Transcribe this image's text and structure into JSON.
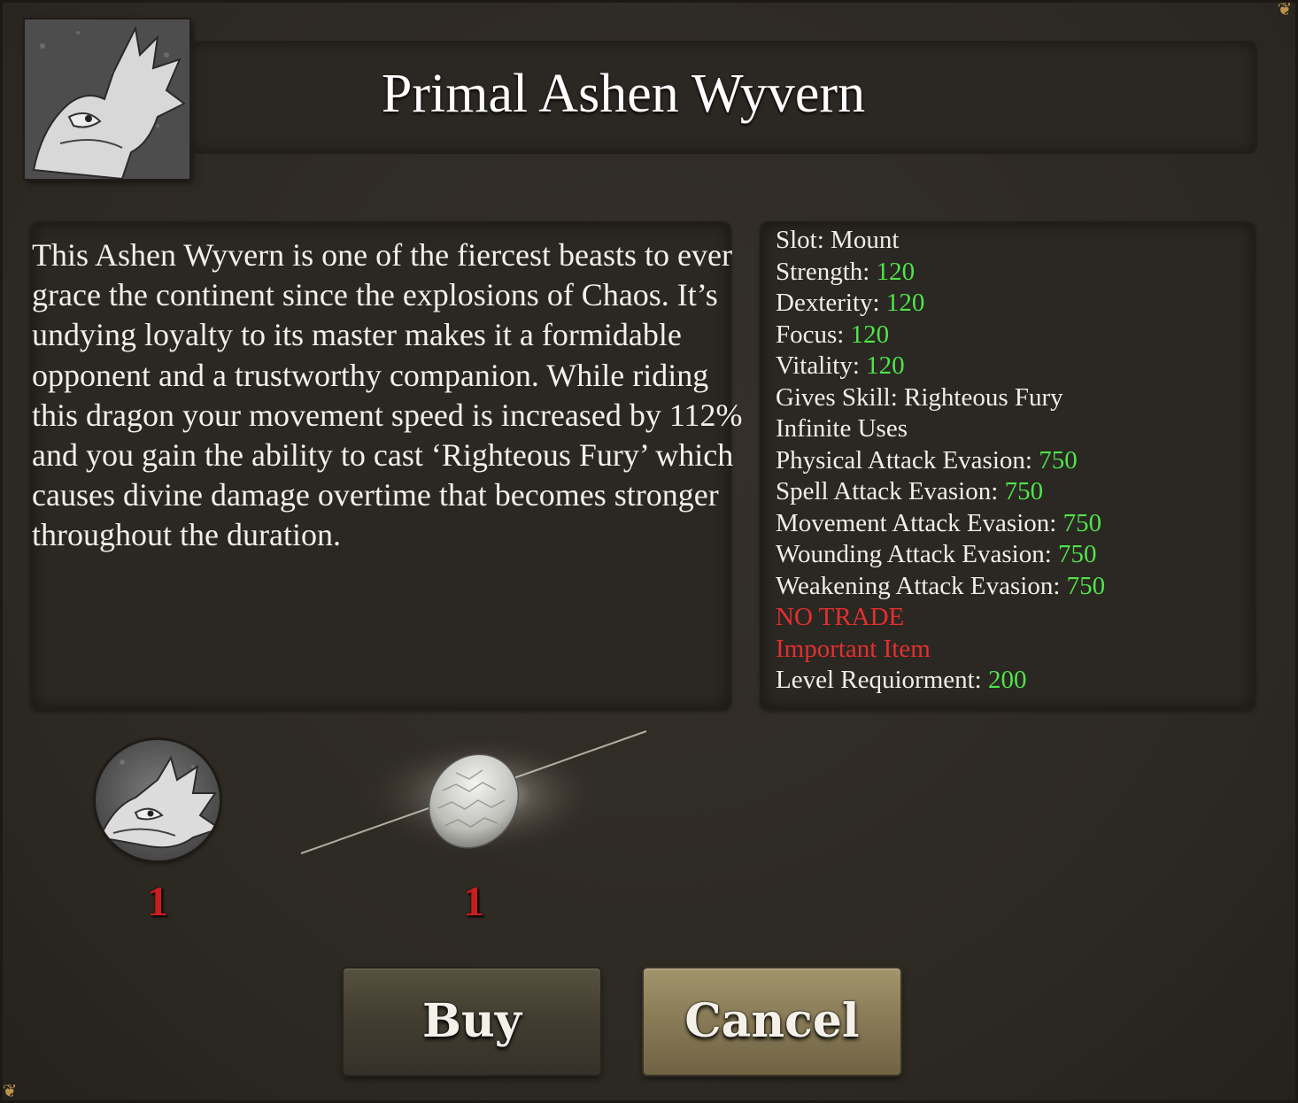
{
  "item": {
    "name": "Primal Ashen Wyvern",
    "portrait_icon": "wyvern-portrait-icon"
  },
  "description": "This Ashen Wyvern is one of the fiercest beasts to ever grace the continent since the explosions of Chaos. It’s undying loyalty to its master makes it a formidable opponent and a trustworthy companion. While riding this dragon your movement speed is increased by 112% and you gain the ability to cast ‘Righteous Fury’ which causes divine damage overtime that becomes stronger throughout the duration.",
  "stats": [
    {
      "label": "Slot: Mount",
      "value": ""
    },
    {
      "label": "Strength: ",
      "value": "120"
    },
    {
      "label": "Dexterity: ",
      "value": "120"
    },
    {
      "label": "Focus: ",
      "value": "120"
    },
    {
      "label": "Vitality: ",
      "value": "120"
    },
    {
      "label": "Gives Skill: Righteous Fury",
      "value": ""
    },
    {
      "label": "Infinite Uses",
      "value": ""
    },
    {
      "label": "Physical Attack Evasion: ",
      "value": "750"
    },
    {
      "label": "Spell Attack Evasion: ",
      "value": "750"
    },
    {
      "label": "Movement Attack Evasion: ",
      "value": "750"
    },
    {
      "label": "Wounding Attack Evasion: ",
      "value": "750"
    },
    {
      "label": "Weakening Attack Evasion: ",
      "value": "750"
    }
  ],
  "flags": [
    "NO TRADE",
    "Important Item"
  ],
  "level_requirement": {
    "label": "Level Requiorment: ",
    "value": "200"
  },
  "rewards": [
    {
      "icon": "wyvern-head-icon",
      "count": "1"
    },
    {
      "icon": "egg-icon",
      "count": "1"
    }
  ],
  "buttons": {
    "buy": "Buy",
    "cancel": "Cancel"
  },
  "colors": {
    "value_green": "#4ee54a",
    "warning_red": "#e23030",
    "count_red": "#c81e1e"
  }
}
